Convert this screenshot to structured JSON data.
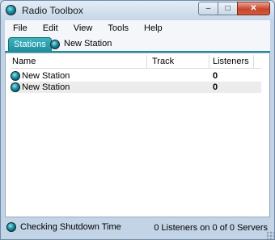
{
  "window": {
    "title": "Radio Toolbox",
    "controls": {
      "minimize": "–",
      "maximize": "□",
      "close": "✕"
    }
  },
  "menu": [
    "File",
    "Edit",
    "View",
    "Tools",
    "Help"
  ],
  "tabs": {
    "active": "Stations",
    "station_tab": "New Station"
  },
  "table": {
    "columns": [
      "Name",
      "Track",
      "Listeners"
    ],
    "rows": [
      {
        "name": "New Station",
        "track": "",
        "listeners": "0"
      },
      {
        "name": "New Station",
        "track": "",
        "listeners": "0"
      }
    ]
  },
  "status": {
    "left": "Checking Shutdown Time",
    "right": "0 Listeners on 0 of 0 Servers"
  },
  "colors": {
    "accent_tab": "#1d8e9c",
    "close_button": "#c8452c"
  },
  "icons": {
    "app": "globe-icon",
    "station": "globe-icon"
  }
}
